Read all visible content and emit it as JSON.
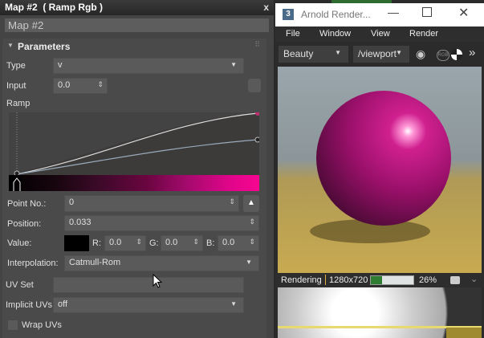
{
  "material_panel": {
    "title": "Map #2  ( Ramp Rgb )",
    "close": "x",
    "name_value": "Map #2",
    "rollout_title": "Parameters",
    "type_label": "Type",
    "type_value": "v",
    "input_label": "Input",
    "input_value": "0.0",
    "ramp_label": "Ramp",
    "ramp_colors": [
      "#000000",
      "#f70590"
    ],
    "point_no_label": "Point No.:",
    "point_no_value": "0",
    "position_label": "Position:",
    "position_value": "0.033",
    "value_label": "Value:",
    "value_color": "#000000",
    "r_label": "R:",
    "r_value": "0.0",
    "g_label": "G:",
    "g_value": "0.0",
    "b_label": "B:",
    "b_value": "0.0",
    "interpolation_label": "Interpolation:",
    "interpolation_value": "Catmull-Rom",
    "uv_set_label": "UV Set",
    "uv_set_value": "",
    "implicit_uvs_label": "Implicit UVs",
    "implicit_uvs_value": "off",
    "wrap_uvs_label": "Wrap UVs"
  },
  "render_window": {
    "title": "Arnold Render...",
    "menu": [
      "File",
      "Window",
      "View",
      "Render"
    ],
    "aov_value": "Beauty",
    "camera_value": "/viewport",
    "rgb_label": "RGB",
    "status_text": "Rendering",
    "resolution": "1280x720",
    "progress_percent": 26,
    "progress_label": "26%"
  }
}
